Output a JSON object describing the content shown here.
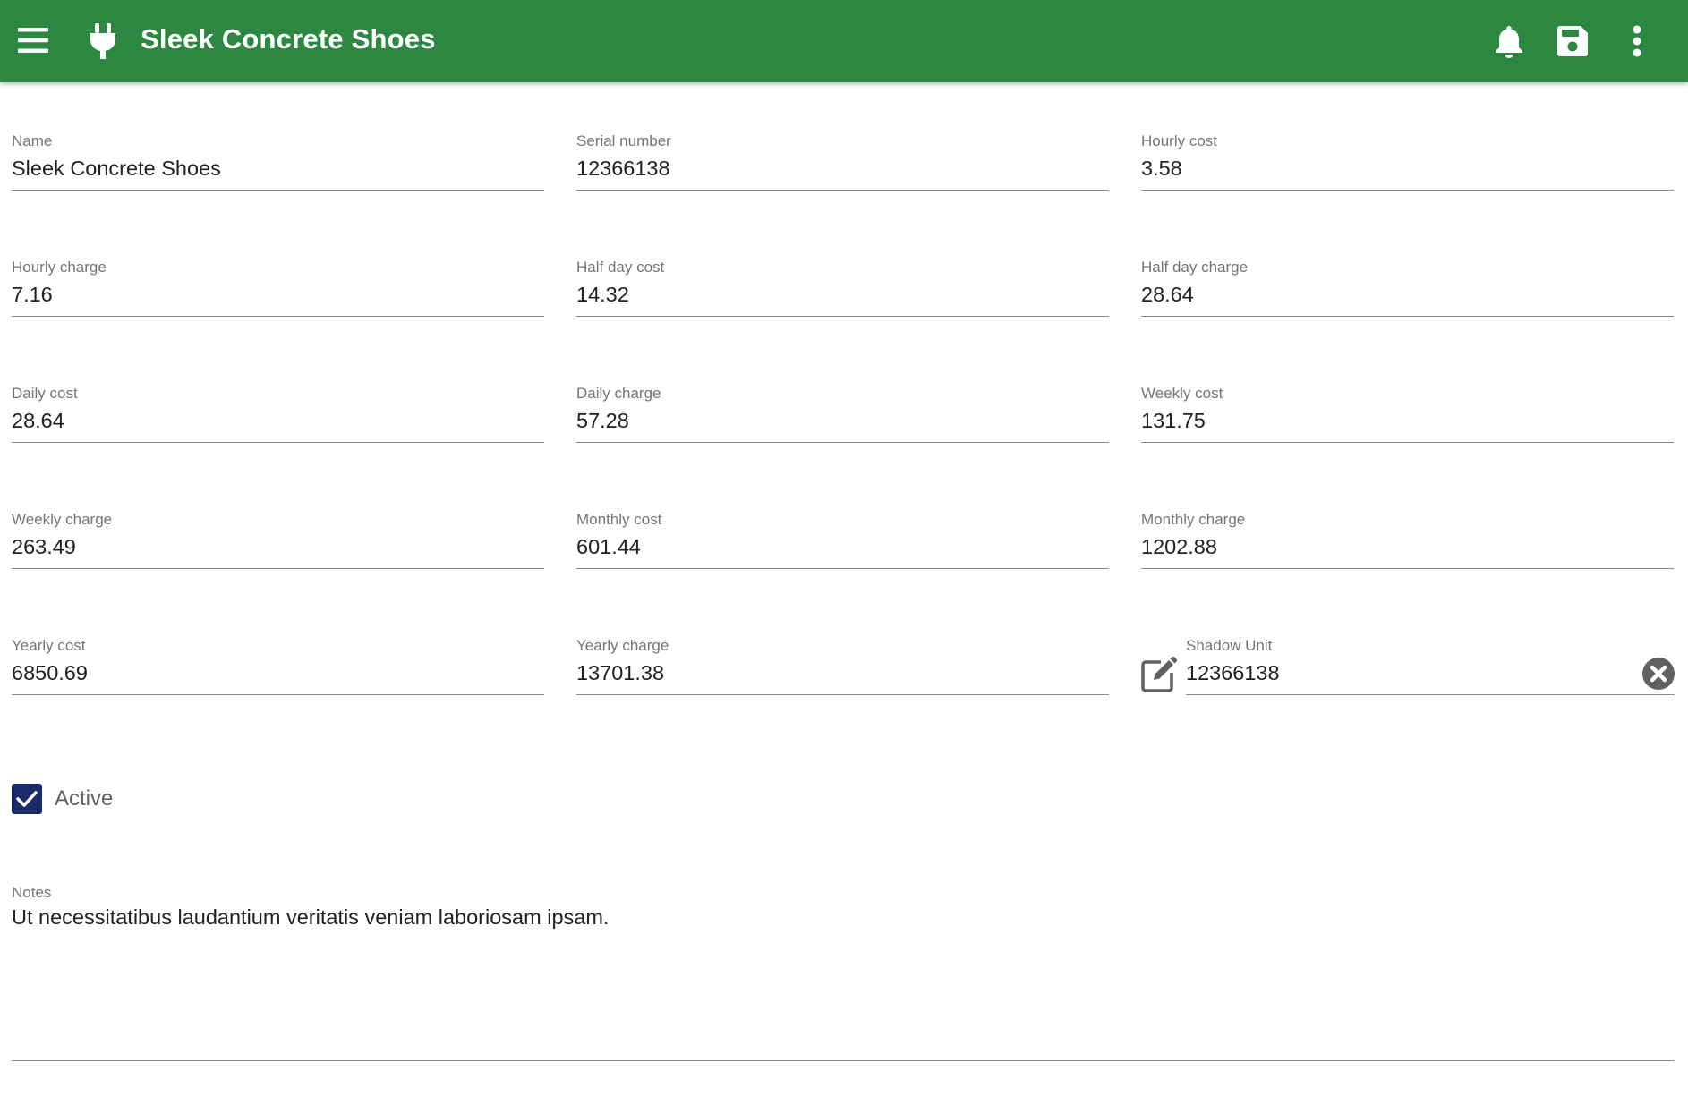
{
  "appbar": {
    "title": "Sleek Concrete Shoes",
    "color": "#2c8741",
    "icons": [
      "menu-icon",
      "plug-icon",
      "bell-icon",
      "save-icon",
      "more-vert-icon"
    ]
  },
  "fields": {
    "name": {
      "label": "Name",
      "value": "Sleek Concrete Shoes"
    },
    "serial_number": {
      "label": "Serial number",
      "value": "12366138"
    },
    "hourly_cost": {
      "label": "Hourly cost",
      "value": "3.58"
    },
    "hourly_charge": {
      "label": "Hourly charge",
      "value": "7.16"
    },
    "half_day_cost": {
      "label": "Half day cost",
      "value": "14.32"
    },
    "half_day_charge": {
      "label": "Half day charge",
      "value": "28.64"
    },
    "daily_cost": {
      "label": "Daily cost",
      "value": "28.64"
    },
    "daily_charge": {
      "label": "Daily charge",
      "value": "57.28"
    },
    "weekly_cost": {
      "label": "Weekly cost",
      "value": "131.75"
    },
    "weekly_charge": {
      "label": "Weekly charge",
      "value": "263.49"
    },
    "monthly_cost": {
      "label": "Monthly cost",
      "value": "601.44"
    },
    "monthly_charge": {
      "label": "Monthly charge",
      "value": "1202.88"
    },
    "yearly_cost": {
      "label": "Yearly cost",
      "value": "6850.69"
    },
    "yearly_charge": {
      "label": "Yearly charge",
      "value": "13701.38"
    },
    "shadow_unit": {
      "label": "Shadow Unit",
      "value": "12366138"
    }
  },
  "active": {
    "label": "Active",
    "checked": true,
    "color": "#1a2b6b"
  },
  "notes": {
    "label": "Notes",
    "value": "Ut necessitatibus laudantium veritatis veniam laboriosam ipsam."
  }
}
